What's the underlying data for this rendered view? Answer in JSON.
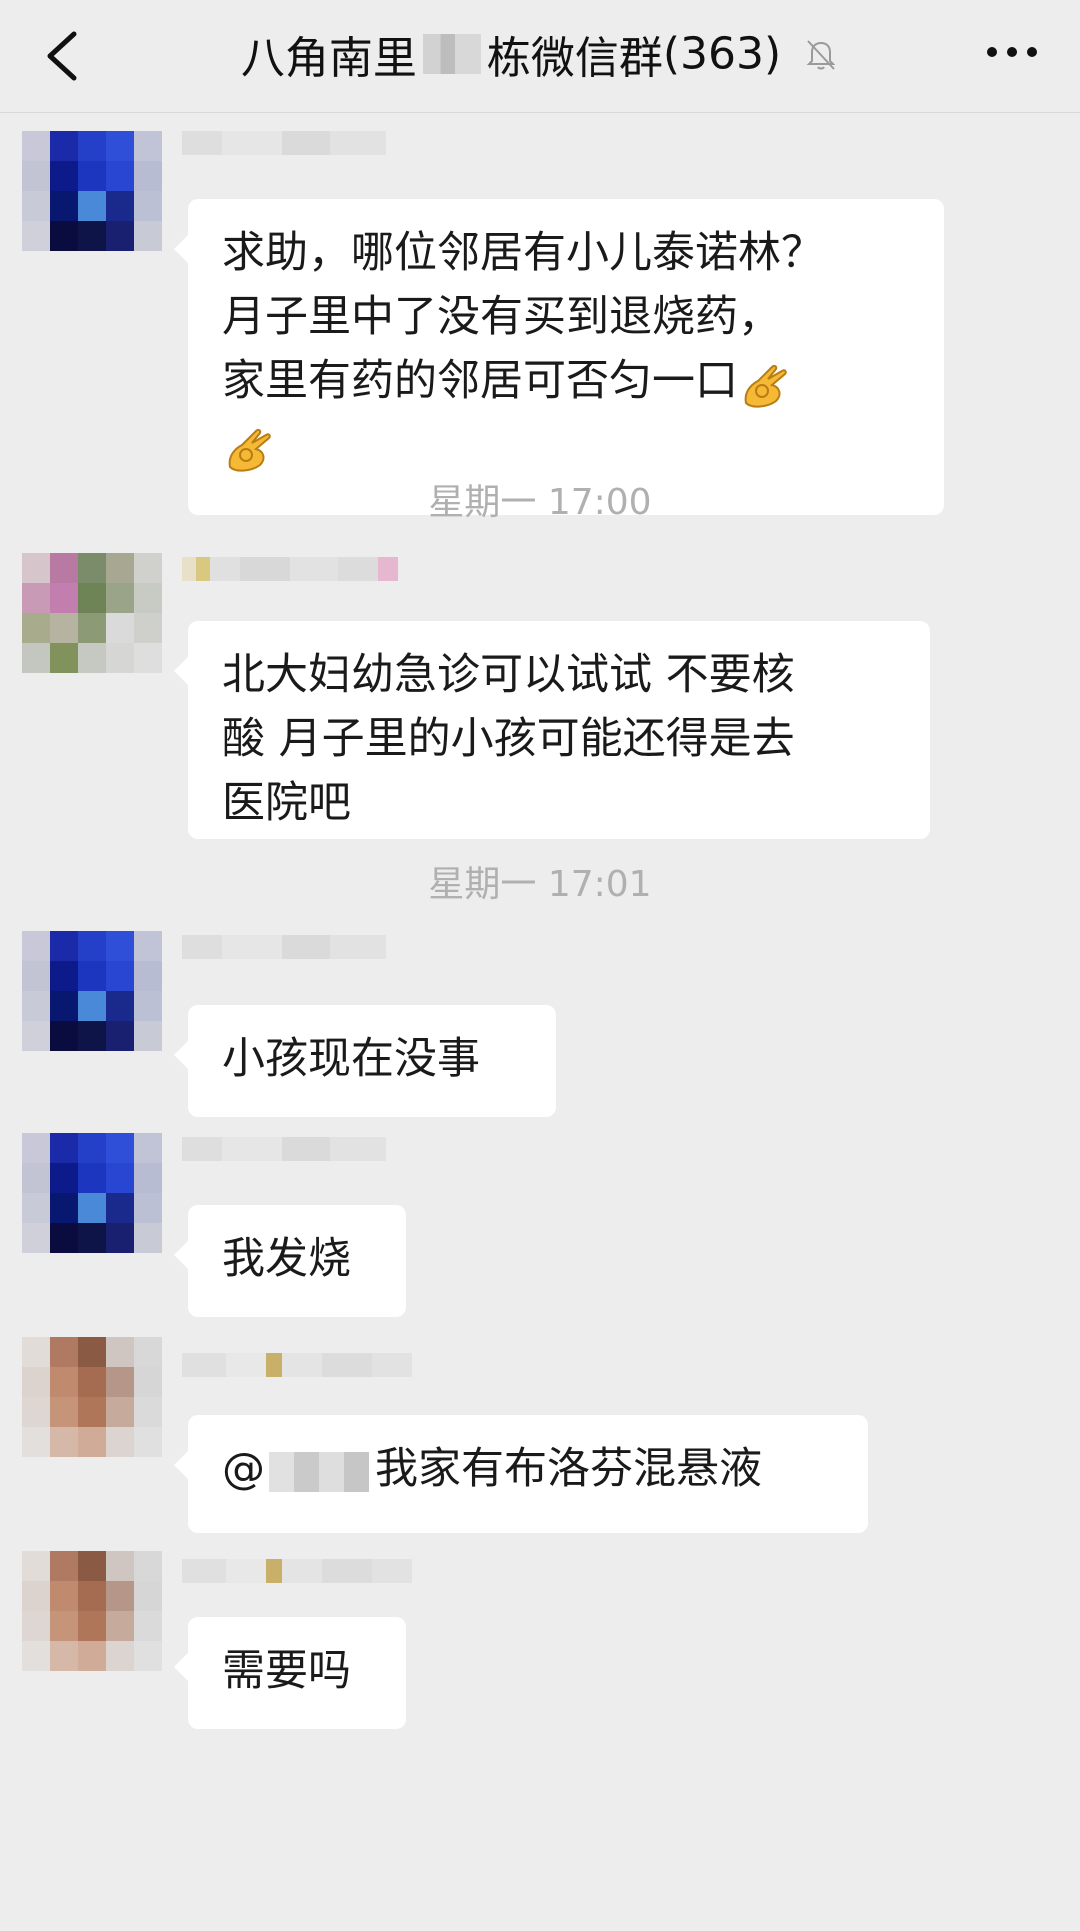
{
  "header": {
    "title_part1": "八角南里",
    "title_part2": "栋微信群",
    "member_count": "(363)"
  },
  "messages": [
    {
      "lines": [
        "求助，哪位邻居有小儿泰诺林？",
        "月子里中了没有买到退烧药，",
        "家里有药的邻居可否匀一口"
      ],
      "emoji": "👌"
    },
    {
      "time": "星期一 17:00"
    },
    {
      "lines": [
        "北大妇幼急诊可以试试  不要核",
        "酸 月子里的小孩可能还得是去",
        "医院吧"
      ]
    },
    {
      "time": "星期一 17:01"
    },
    {
      "lines": [
        "小孩现在没事"
      ]
    },
    {
      "lines": [
        "我发烧"
      ]
    },
    {
      "mention_prefix": "@",
      "text": "我家有布洛芬混悬液"
    },
    {
      "lines": [
        "需要吗"
      ]
    }
  ],
  "icons": {
    "back": "chevron-left-icon",
    "mute": "bell-off-icon",
    "more": "more-dots-icon",
    "emoji": "ok-hand-emoji"
  },
  "colors": {
    "background": "#ededed",
    "bubble": "#ffffff",
    "timestamp": "#b0b0b0",
    "text": "#1a1a1a"
  }
}
